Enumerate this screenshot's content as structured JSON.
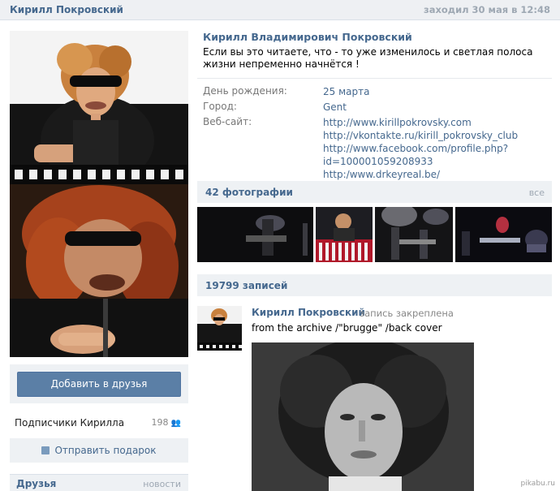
{
  "header": {
    "name": "Кирилл Покровский",
    "last_seen": "заходил 30 мая в 12:48"
  },
  "profile": {
    "full_name": "Кирилл Владимирович Покровский",
    "status": "Если вы это читаете, что - то уже изменилось и светлая полоса жизни непременно начнётся !",
    "info": {
      "birthday_label": "День рождения:",
      "birthday_value": "25 марта",
      "city_label": "Город:",
      "city_value": "Gent",
      "website_label": "Веб-сайт:",
      "websites": [
        "http://www.kirillpokrovsky.com",
        "http://vkontakte.ru/kirill_pokrovsky_club",
        "http://www.facebook.com/profile.php?",
        "id=100001059208933",
        "http:/www.drkeyreal.be/"
      ]
    }
  },
  "sidebar": {
    "add_friend_label": "Добавить в друзья",
    "subscribers_label": "Подписчики Кирилла",
    "subscribers_count": "198",
    "gift_label": "Отправить подарок",
    "friends_label": "Друзья",
    "friends_right": "новости"
  },
  "photos": {
    "title": "42 фотографии",
    "all_label": "все"
  },
  "wall": {
    "title": "19799 записей",
    "post": {
      "author": "Кирилл Покровский",
      "pinned": "запись закреплена",
      "text": "from the archive /\"brugge\" /back cover"
    }
  },
  "watermark": "pikabu.ru",
  "colors": {
    "link": "#45688e",
    "header_bg": "#eef0f3",
    "button": "#5b7fa6"
  }
}
